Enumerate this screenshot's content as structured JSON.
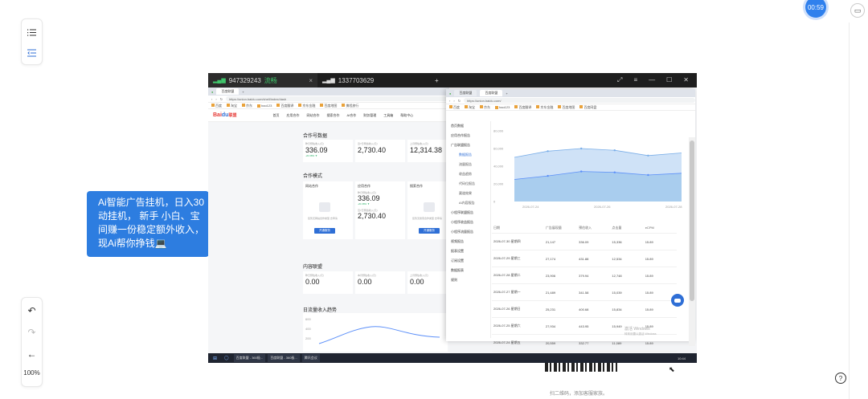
{
  "app": {
    "timer": "00:59",
    "zoom": "100%",
    "help": "?",
    "callout_lines": [
      "Ai智能广告挂机，日入30",
      "动挂机， 新手 小白、宝",
      "间赚一份稳定额外收入，",
      "现Ai帮你挣钱💻"
    ],
    "qr_caption": "扫二维码，添加客服家族。"
  },
  "remote": {
    "tabs": [
      {
        "id": "947329243",
        "status": "流畅"
      },
      {
        "id": "1337703629"
      }
    ],
    "plus": "+",
    "close": "×",
    "controls": [
      "⤢",
      "≡",
      "—",
      "☐",
      "✕"
    ]
  },
  "browser1": {
    "tab_title": "百度联盟",
    "url": "https://union.baidu.com/shell/index/dash",
    "bookmarks": [
      "百度",
      "淘宝",
      "京东",
      "hao123",
      "百度翻译",
      "京东金融",
      "百度地图",
      "携程旅行",
      "百度网盘"
    ],
    "logo": {
      "bai": "Bai",
      "du": "du",
      "suffix": "联盟"
    },
    "nav": [
      "首页",
      "应用合作",
      "网站合作",
      "搜索合作",
      "AI合作",
      "财务管理",
      "工具箱",
      "帮助中心"
    ],
    "sections": {
      "coop_data": "合作号数据",
      "coop_mode": "合作模式",
      "content": "内容联盟",
      "trend": "日流量收入趋势"
    },
    "cards": [
      {
        "label": "昨日预估收入(元)",
        "value": "336.09",
        "change": "-20.38% ▼"
      },
      {
        "label": "近7日预估收入(元)",
        "value": "2,730.40",
        "change": ""
      },
      {
        "label": "上月预估收入(元)",
        "value": "12,314.38",
        "change": ""
      }
    ],
    "coops": [
      {
        "name": "网站合作",
        "btn": "开通服务",
        "note": "您暂无网站合作类型 去申请"
      },
      {
        "name": "应用合作",
        "value1": "336.09",
        "change": "-20.38% ▼",
        "value2": "2,730.40",
        "label1": "昨日预估收入(元)",
        "label2": "近7日预估收入(元)"
      },
      {
        "name": "搜索合作",
        "btn": "开通服务",
        "note": "您暂无搜索合作类型 去申请"
      }
    ],
    "content_cards": [
      {
        "label": "昨日预估收入(元)",
        "value": "0.00"
      },
      {
        "label": "本月预估收入(元)",
        "value": "0.00"
      },
      {
        "label": "上月预估收入(元)",
        "value": "0.00"
      }
    ],
    "trend_ticks": [
      "600",
      "400",
      "200"
    ]
  },
  "browser2": {
    "tab1": "百度联盟",
    "tab2": "百度联盟",
    "url": "https://union.baidu.com/",
    "side_items": [
      "首页数据",
      "应用合作报告",
      "广告联盟报告",
      "数据报告",
      "流量报告",
      "收益趋势",
      "代码位报告",
      "渠道效果",
      "AI内容报告",
      "小程序联盟报告",
      "小程序收益报告",
      "小程序流量报告",
      "视频报告",
      "报表设置",
      "订阅设置",
      "数据报表",
      "规则"
    ],
    "chart_data": {
      "type": "area",
      "title": "",
      "y_ticks": [
        "80,000",
        "60,000",
        "40,000",
        "20,000",
        "0"
      ],
      "x": [
        "2026-07-24",
        "2026-07-26",
        "2026-07-28"
      ],
      "series": [
        {
          "values": [
            50000,
            57000,
            60000,
            58000,
            52000,
            55000
          ]
        },
        {
          "values": [
            25000,
            29000,
            34000,
            33000,
            30000,
            32000
          ]
        }
      ],
      "ylim": [
        0,
        80000
      ]
    },
    "table": {
      "headers": [
        "日期",
        "广告展现量",
        "预估收入",
        "点击量",
        "eCPM"
      ],
      "rows": [
        [
          "2026-07-30 星期四",
          "21,147",
          "336.09",
          "15,336",
          "15.89"
        ],
        [
          "2026-07-29 星期三",
          "27,174",
          "431.88",
          "12,534",
          "15.89"
        ],
        [
          "2026-07-28 星期二",
          "23,906",
          "379.94",
          "12,748",
          "15.89"
        ],
        [
          "2026-07-27 星期一",
          "21,489",
          "341.58",
          "15,039",
          "15.89"
        ],
        [
          "2026-07-26 星期日",
          "25,231",
          "400.68",
          "15,834",
          "15.89"
        ],
        [
          "2026-07-25 星期六",
          "27,934",
          "443.95",
          "15,949",
          "15.89"
        ],
        [
          "2026-07-24 星期五",
          "20,559",
          "332.77",
          "11,089",
          "15.89"
        ]
      ]
    },
    "watermark_line1": "激活 Windows",
    "watermark_line2": "转到设置以激活 Windows"
  },
  "taskbar": {
    "items": [
      "百度联盟 - 360极...",
      "百度联盟 - 360极...",
      "腾讯会议"
    ],
    "clock": "10:44"
  }
}
